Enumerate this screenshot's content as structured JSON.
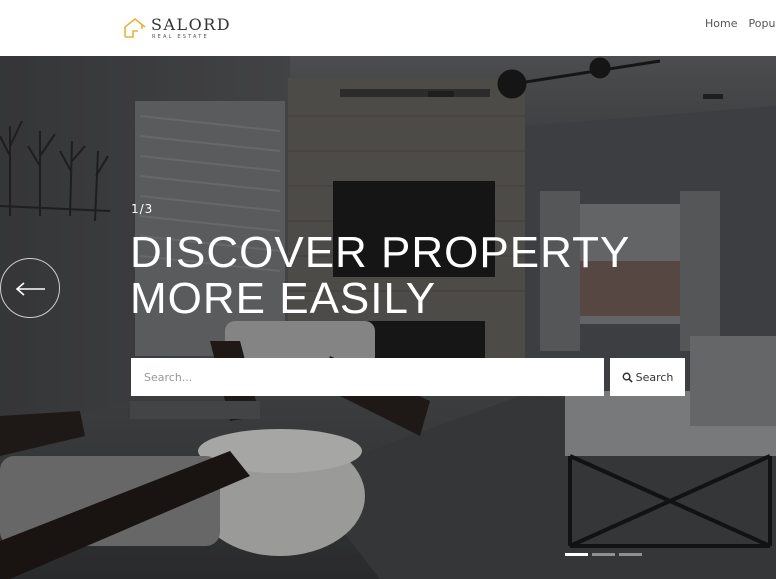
{
  "brand": {
    "name": "SALORD",
    "tagline": "REAL ESTATE",
    "logo_icon": "house-icon",
    "accent_color": "#e8b23a"
  },
  "nav": {
    "items": [
      {
        "label": "Home"
      },
      {
        "label": "Popu"
      }
    ]
  },
  "hero": {
    "counter": "1/3",
    "headline_line1": "DISCOVER PROPERTY",
    "headline_line2": "MORE EASILY",
    "prev_icon": "arrow-left-icon",
    "slides_total": 3,
    "active_slide": 1
  },
  "search": {
    "placeholder": "Search...",
    "button_label": "Search",
    "button_icon": "search-icon"
  }
}
